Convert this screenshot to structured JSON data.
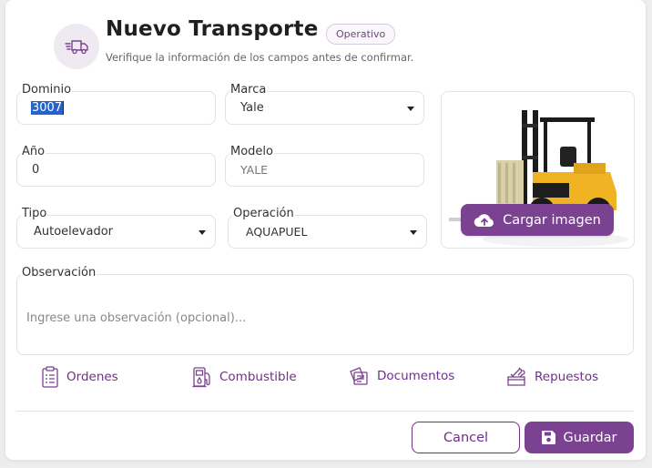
{
  "header": {
    "icon": "truck-icon",
    "title": "Nuevo Transporte",
    "status_badge": "Operativo",
    "subtitle": "Verifique la información de los campos antes de confirmar."
  },
  "form": {
    "dominio": {
      "label": "Dominio",
      "value": "3007"
    },
    "marca": {
      "label": "Marca",
      "value": "Yale"
    },
    "anio": {
      "label": "Año",
      "value": "0"
    },
    "modelo": {
      "label": "Modelo",
      "value": "YALE"
    },
    "tipo": {
      "label": "Tipo",
      "value": "Autoelevador"
    },
    "operacion": {
      "label": "Operación",
      "value": "AQUAPUEL"
    },
    "observacion": {
      "label": "Observación",
      "placeholder": "Ingrese una observación (opcional)..."
    }
  },
  "image_panel": {
    "image_alt": "forklift-image",
    "upload_label": "Cargar imagen",
    "upload_icon": "cloud-upload-icon"
  },
  "actions": [
    {
      "label": "Ordenes",
      "icon": "clipboard-list-icon"
    },
    {
      "label": "Combustible",
      "icon": "fuel-pump-icon"
    },
    {
      "label": "Documentos",
      "icon": "documents-icon"
    },
    {
      "label": "Repuestos",
      "icon": "spare-parts-icon"
    }
  ],
  "footer": {
    "cancel_label": "Cancel",
    "save_label": "Guardar",
    "save_icon": "floppy-disk-icon"
  },
  "colors": {
    "accent": "#7a4290",
    "accent_text": "#6e2f8a",
    "badge_bg": "#faf7fb"
  }
}
